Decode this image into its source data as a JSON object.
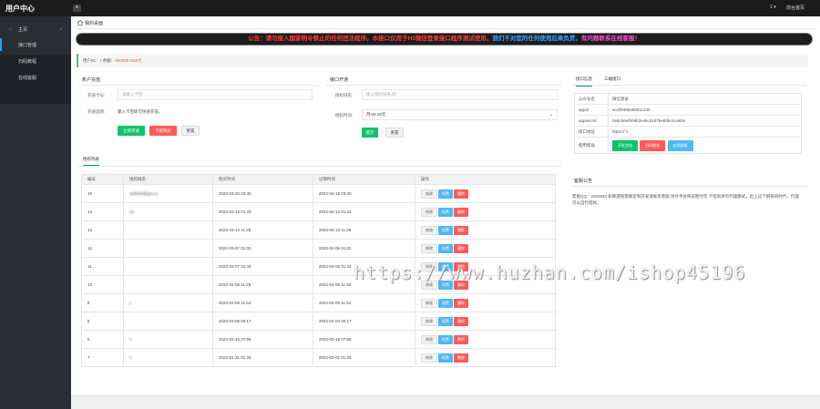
{
  "brand": "用户中心",
  "topbar": {
    "user": "1 ▾",
    "home": "前台首页"
  },
  "sidebar": {
    "items": [
      {
        "label": "主页"
      },
      {
        "label": "接口管理"
      },
      {
        "label": "扫码教程"
      },
      {
        "label": "在线客服"
      }
    ]
  },
  "breadcrumb": "我的桌面",
  "notice": {
    "parts": [
      {
        "text": "公告：请勿接入国家明令禁止的任何违法程序。本接口仅用于H5微信登录接口程序测试使用，",
        "color": "#ff3b3b"
      },
      {
        "text": "我们不对您的任何使用后果负责，",
        "color": "#3ba7ff"
      },
      {
        "text": "有问题联系在线客服！",
        "color": "#ff4fd8"
      }
    ]
  },
  "account": {
    "prefix": "用户ID：",
    "uid": "1",
    "balance_label": "  余额：",
    "balance": "9000007590元"
  },
  "user_recharge": {
    "title": "账户充值",
    "card_label": "充值卡号:",
    "card_placeholder": "请输入卡密",
    "desc_label": "充值说明:",
    "desc_text": "输入卡密即可快速充值。",
    "btn_recharge": "立即充值",
    "btn_buy": "卡密购买",
    "btn_reset": "重置"
  },
  "api_open": {
    "title": "接口开通",
    "domain_label": "授权域名:",
    "domain_placeholder": "输入授权域名,如：",
    "period_label": "授权时间:",
    "period_value": "月/45.00元",
    "btn_submit": "提交",
    "btn_reset": "重置"
  },
  "api_info": {
    "tabs": [
      "接口信息",
      "三端接口"
    ],
    "rows": [
      {
        "k": "公众号名",
        "v": "微信登录"
      },
      {
        "k": "appid",
        "v": "wx2f9486a65511240"
      },
      {
        "k": "appsecret",
        "v": "0e8c06ef909b2e46cd1076e83bcbca65e"
      },
      {
        "k": "接口地址",
        "v": "https://                         /i"
      },
      {
        "k": "使用帮助",
        "v": ""
      }
    ],
    "btn_doc": "开发文档",
    "btn_tutorial": "扫码教程",
    "btn_online": "在线客服"
  },
  "kefu": {
    "title": "客服公告",
    "text": "客服QQ：2002840 如果遇到需要定制开发请联系客服 另外平台目前暂时无  卡密就将有代理模式，赶上这个钢铁的时代，代理可以自行结款。"
  },
  "list": {
    "tab": "授权列表",
    "headers": [
      "编号",
      "授权域名",
      "购买时间",
      "过期时间",
      "操作"
    ],
    "rows": [
      {
        "id": "16",
        "domain": "sa9000@qei.cn",
        "buy": "2022-03-20 03:40",
        "exp": "2022-04-19 03:40"
      },
      {
        "id": "14",
        "domain": "16  ",
        "buy": "2022-03-15 01:43",
        "exp": "2022-04-14 01:43"
      },
      {
        "id": "13",
        "domain": "         ",
        "buy": "2022-03-14 11:28",
        "exp": "2022-04-13 11:28"
      },
      {
        "id": "12",
        "domain": "     ",
        "buy": "2022-03-07 01:02",
        "exp": "2022-04-06 01:02"
      },
      {
        "id": "11",
        "domain": "     ",
        "buy": "2022-03-07 01:44",
        "exp": "2022-04-06 01:44"
      },
      {
        "id": "10",
        "domain": "     ",
        "buy": "2022-03-06 11:25",
        "exp": "2022-04-05 11:25"
      },
      {
        "id": "9",
        "domain": "       L",
        "buy": "2022-03-06 11:54",
        "exp": "2022-04-05 11:54"
      },
      {
        "id": "8",
        "domain": "        ",
        "buy": "2022-03-05 00:17",
        "exp": "2022-04-04 00:17"
      },
      {
        "id": "5",
        "domain": "      ii",
        "buy": "2022-02-16 07:58",
        "exp": "2022-03-18 07:58"
      },
      {
        "id": "7",
        "domain": "     s",
        "buy": "2022-01-31 01:33",
        "exp": "2022-03-02 01:33"
      }
    ],
    "ops": {
      "edit": "修改",
      "renew": "续费",
      "delete": "删除"
    }
  },
  "watermark": "https://www.huzhan.com/ishop45196"
}
